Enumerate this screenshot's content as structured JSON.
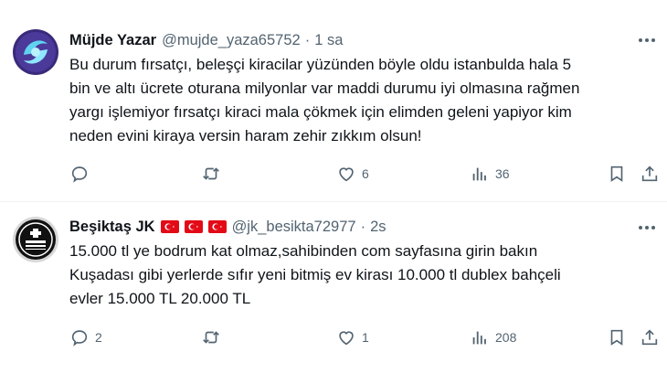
{
  "colors": {
    "text": "#0f1419",
    "secondary": "#536471",
    "divider": "#eff3f4",
    "flag_red": "#e30a17"
  },
  "tweets": [
    {
      "name": "Müjde Yazar",
      "handle": "@mujde_yaza65752",
      "separator": "·",
      "time": "1 sa",
      "lines": [
        "Bu durum fırsatçı, beleşçi kiracilar yüzünden böyle oldu istanbulda hala 5",
        "bin ve altı ücrete oturana milyonlar var maddi durumu iyi olmasına rağmen",
        "yargı işlemiyor fırsatçı kiraci mala çökmek için elimden geleni yapiyor kim",
        "neden evini kiraya versin  haram zehir zıkkım olsun!"
      ],
      "replies": "",
      "retweets": "",
      "likes": "6",
      "views": "36",
      "icons": [
        "reply-icon",
        "retweet-icon",
        "like-icon",
        "views-icon",
        "bookmark-icon",
        "share-icon",
        "more-icon"
      ]
    },
    {
      "name": "Beşiktaş JK",
      "handle": "@jk_besikta72977",
      "separator": "·",
      "time": "2s",
      "flags": [
        "turkey-flag-icon",
        "turkey-flag-icon",
        "turkey-flag-icon"
      ],
      "lines": [
        "15.000 tl ye bodrum kat olmaz,sahibinden com sayfasına girin bakın",
        "Kuşadası gibi yerlerde sıfır yeni bitmiş ev kirası 10.000 tl dublex bahçeli",
        "evler 15.000 TL 20.000 TL"
      ],
      "replies": "2",
      "retweets": "",
      "likes": "1",
      "views": "208",
      "icons": [
        "reply-icon",
        "retweet-icon",
        "like-icon",
        "views-icon",
        "bookmark-icon",
        "share-icon",
        "more-icon"
      ]
    }
  ]
}
